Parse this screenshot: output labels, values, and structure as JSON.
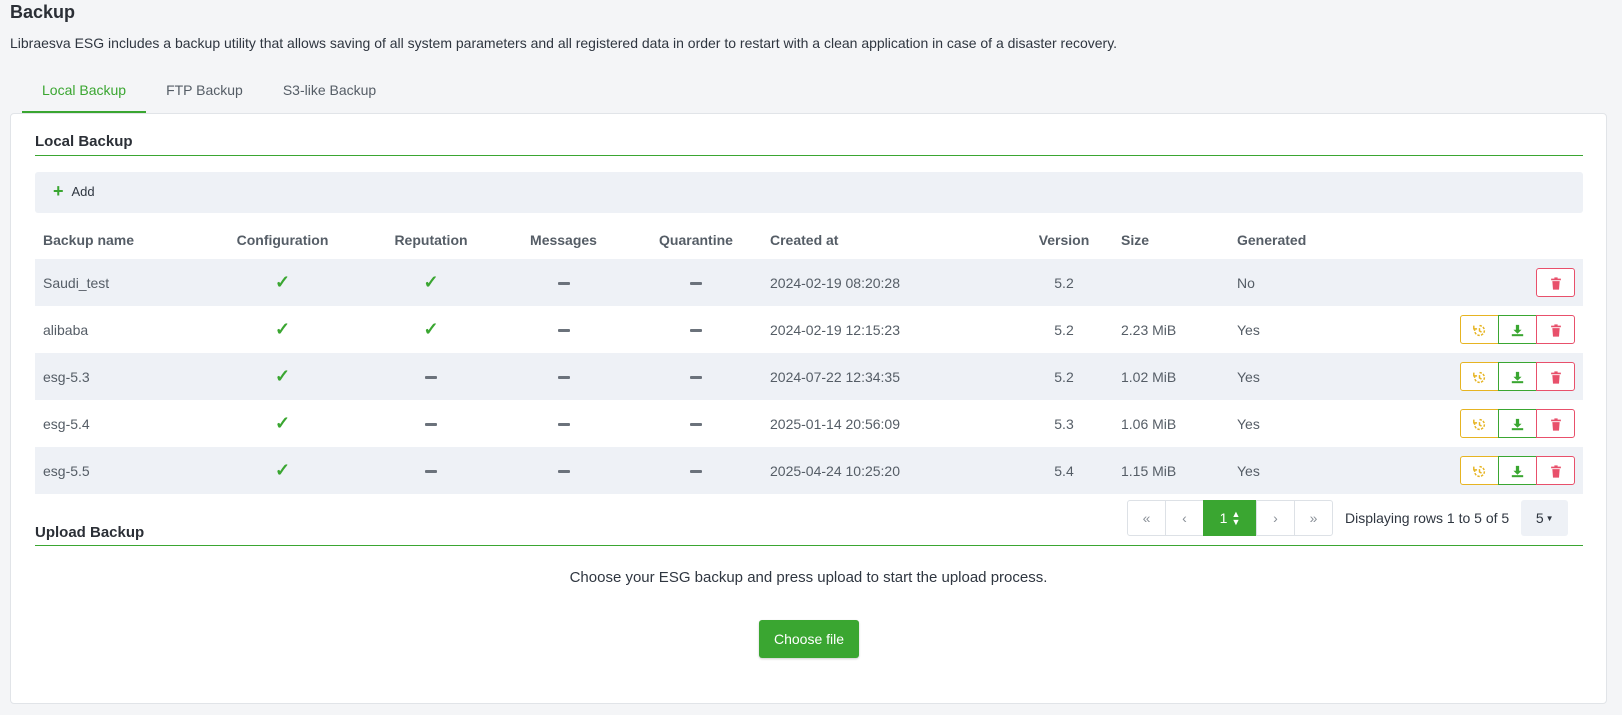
{
  "page": {
    "title": "Backup",
    "description": "Libraesva ESG includes a backup utility that allows saving of all system parameters and all registered data in order to restart with a clean application in case of a disaster recovery."
  },
  "tabs": [
    {
      "label": "Local Backup",
      "active": true
    },
    {
      "label": "FTP Backup",
      "active": false
    },
    {
      "label": "S3-like Backup",
      "active": false
    }
  ],
  "local_backup": {
    "title": "Local Backup",
    "add_label": "Add",
    "columns": [
      "Backup name",
      "Configuration",
      "Reputation",
      "Messages",
      "Quarantine",
      "Created at",
      "Version",
      "Size",
      "Generated"
    ],
    "rows": [
      {
        "name": "Saudi_test",
        "configuration": true,
        "reputation": true,
        "messages": false,
        "quarantine": false,
        "created_at": "2024-02-19 08:20:28",
        "version": "5.2",
        "size": "",
        "generated": "No",
        "actions": [
          "delete"
        ]
      },
      {
        "name": "alibaba",
        "configuration": true,
        "reputation": true,
        "messages": false,
        "quarantine": false,
        "created_at": "2024-02-19 12:15:23",
        "version": "5.2",
        "size": "2.23 MiB",
        "generated": "Yes",
        "actions": [
          "restore",
          "download",
          "delete"
        ]
      },
      {
        "name": "esg-5.3",
        "configuration": true,
        "reputation": false,
        "messages": false,
        "quarantine": false,
        "created_at": "2024-07-22 12:34:35",
        "version": "5.2",
        "size": "1.02 MiB",
        "generated": "Yes",
        "actions": [
          "restore",
          "download",
          "delete"
        ]
      },
      {
        "name": "esg-5.4",
        "configuration": true,
        "reputation": false,
        "messages": false,
        "quarantine": false,
        "created_at": "2025-01-14 20:56:09",
        "version": "5.3",
        "size": "1.06 MiB",
        "generated": "Yes",
        "actions": [
          "restore",
          "download",
          "delete"
        ]
      },
      {
        "name": "esg-5.5",
        "configuration": true,
        "reputation": false,
        "messages": false,
        "quarantine": false,
        "created_at": "2025-04-24 10:25:20",
        "version": "5.4",
        "size": "1.15 MiB",
        "generated": "Yes",
        "actions": [
          "restore",
          "download",
          "delete"
        ]
      }
    ],
    "pagination": {
      "current_page": "1",
      "info": "Displaying rows 1 to 5 of 5",
      "page_size": "5"
    }
  },
  "upload": {
    "title": "Upload Backup",
    "description": "Choose your ESG backup and press upload to start the upload process.",
    "button_label": "Choose file"
  },
  "colors": {
    "accent": "#3aa631",
    "restore": "#e6b422",
    "delete": "#e8506b"
  }
}
